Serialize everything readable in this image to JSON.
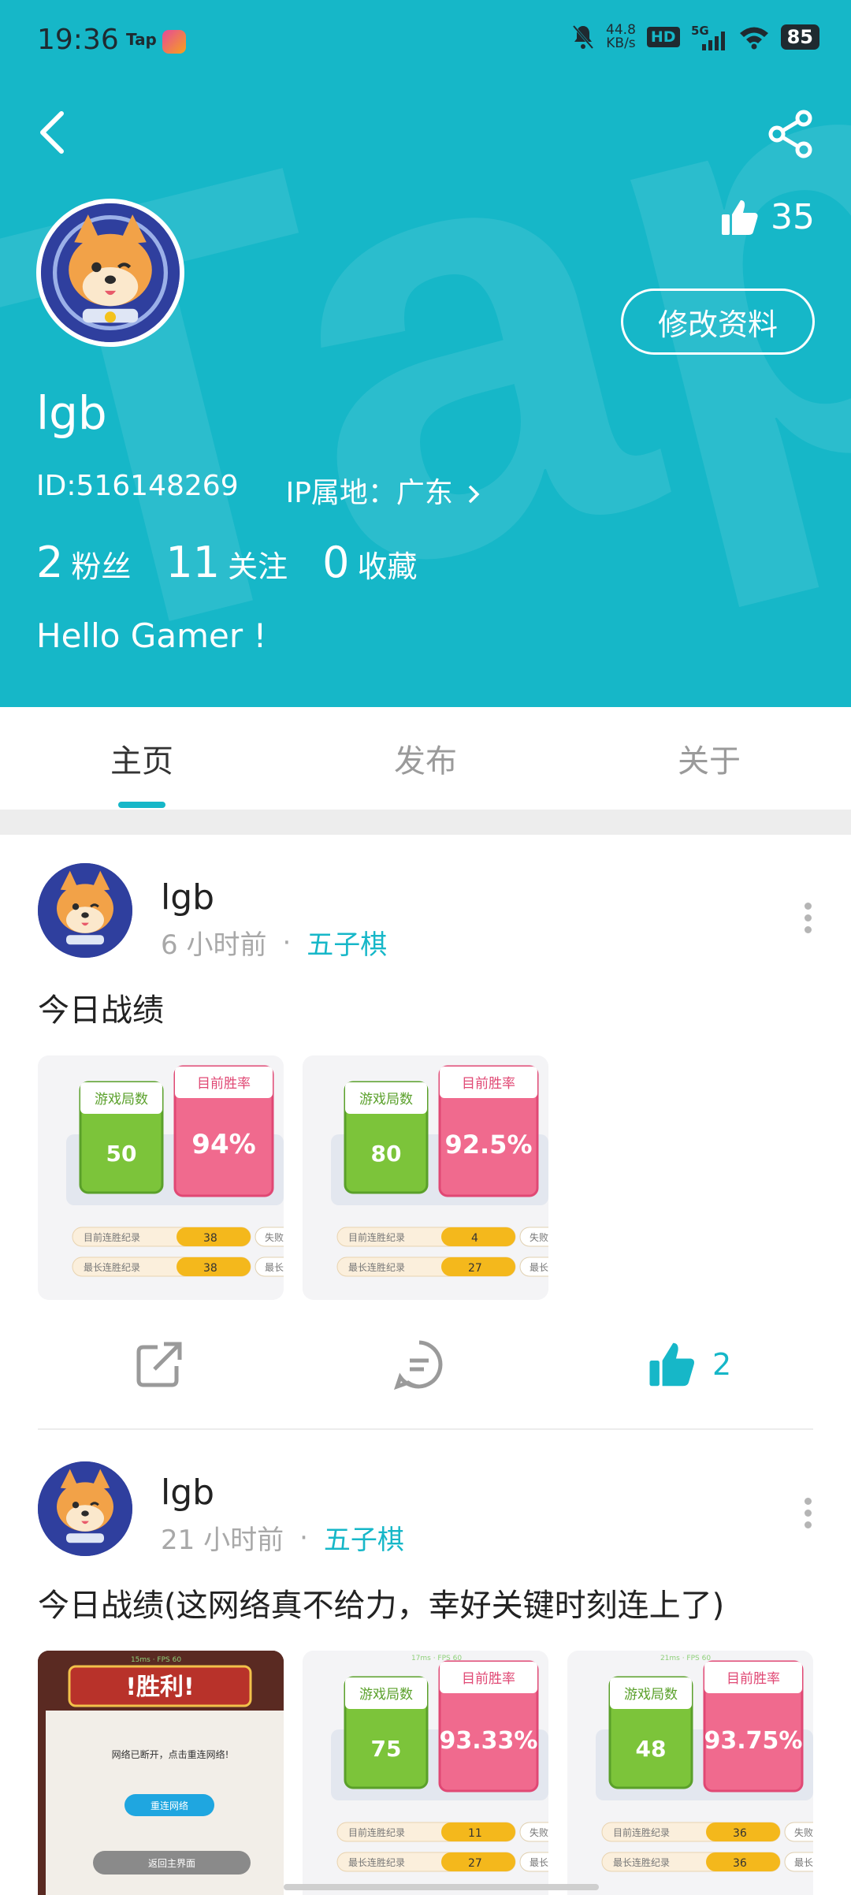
{
  "status_bar": {
    "time": "19:36",
    "tap": "Tap",
    "net_speed": "44.8",
    "net_unit": "KB/s",
    "hd": "HD",
    "network": "5G",
    "battery": "85"
  },
  "profile": {
    "likes": "35",
    "edit_button": "修改资料",
    "username": "lgb",
    "id": "ID:516148269",
    "ip": "IP属地：广东",
    "stats": [
      {
        "number": "2",
        "label": "粉丝"
      },
      {
        "number": "11",
        "label": "关注"
      },
      {
        "number": "0",
        "label": "收藏"
      }
    ],
    "bio": "Hello Gamer !"
  },
  "tabs": [
    "主页",
    "发布",
    "关于"
  ],
  "posts": [
    {
      "author": "lgb",
      "time": "6 小时前",
      "tag": "五子棋",
      "text": "今日战绩",
      "likes": "2",
      "images": [
        {
          "games_label": "游戏局数",
          "games": "50",
          "rate_label": "目前胜率",
          "rate": "94%",
          "row1_label": "目前连胜纪录",
          "row1_value": "38",
          "row1_side": "失败次数",
          "row2_label": "最长连胜纪录",
          "row2_value": "38",
          "row2_side": "最长连败纪录"
        },
        {
          "games_label": "游戏局数",
          "games": "80",
          "rate_label": "目前胜率",
          "rate": "92.5%",
          "row1_label": "目前连胜纪录",
          "row1_value": "4",
          "row1_side": "失败次数",
          "row2_label": "最长连胜纪录",
          "row2_value": "27",
          "row2_side": "最长连败纪录"
        }
      ]
    },
    {
      "author": "lgb",
      "time": "21 小时前",
      "tag": "五子棋",
      "text": "今日战绩(这网络真不给力，幸好关键时刻连上了)",
      "victory": {
        "title": "!胜利!",
        "top": "15ms · FPS 60",
        "msg": "网络已断开，点击重连网络!",
        "reconnect": "重连网络",
        "home": "返回主界面"
      },
      "images": [
        {
          "top": "17ms · FPS 60",
          "games_label": "游戏局数",
          "games": "75",
          "rate_label": "目前胜率",
          "rate": "93.33%",
          "row1_label": "目前连胜纪录",
          "row1_value": "11",
          "row1_side": "失败次数",
          "row2_label": "最长连胜纪录",
          "row2_value": "27",
          "row2_side": "最长连败纪录"
        },
        {
          "top": "21ms · FPS 60",
          "games_label": "游戏局数",
          "games": "48",
          "rate_label": "目前胜率",
          "rate": "93.75%",
          "row1_label": "目前连胜纪录",
          "row1_value": "36",
          "row1_side": "失败次数",
          "row2_label": "最长连胜纪录",
          "row2_value": "36",
          "row2_side": "最长连败纪录"
        }
      ]
    }
  ],
  "colors": {
    "accent": "#16b7c8",
    "green": "#7cc43a",
    "pink": "#f06a8e",
    "gold": "#f4b81c"
  }
}
